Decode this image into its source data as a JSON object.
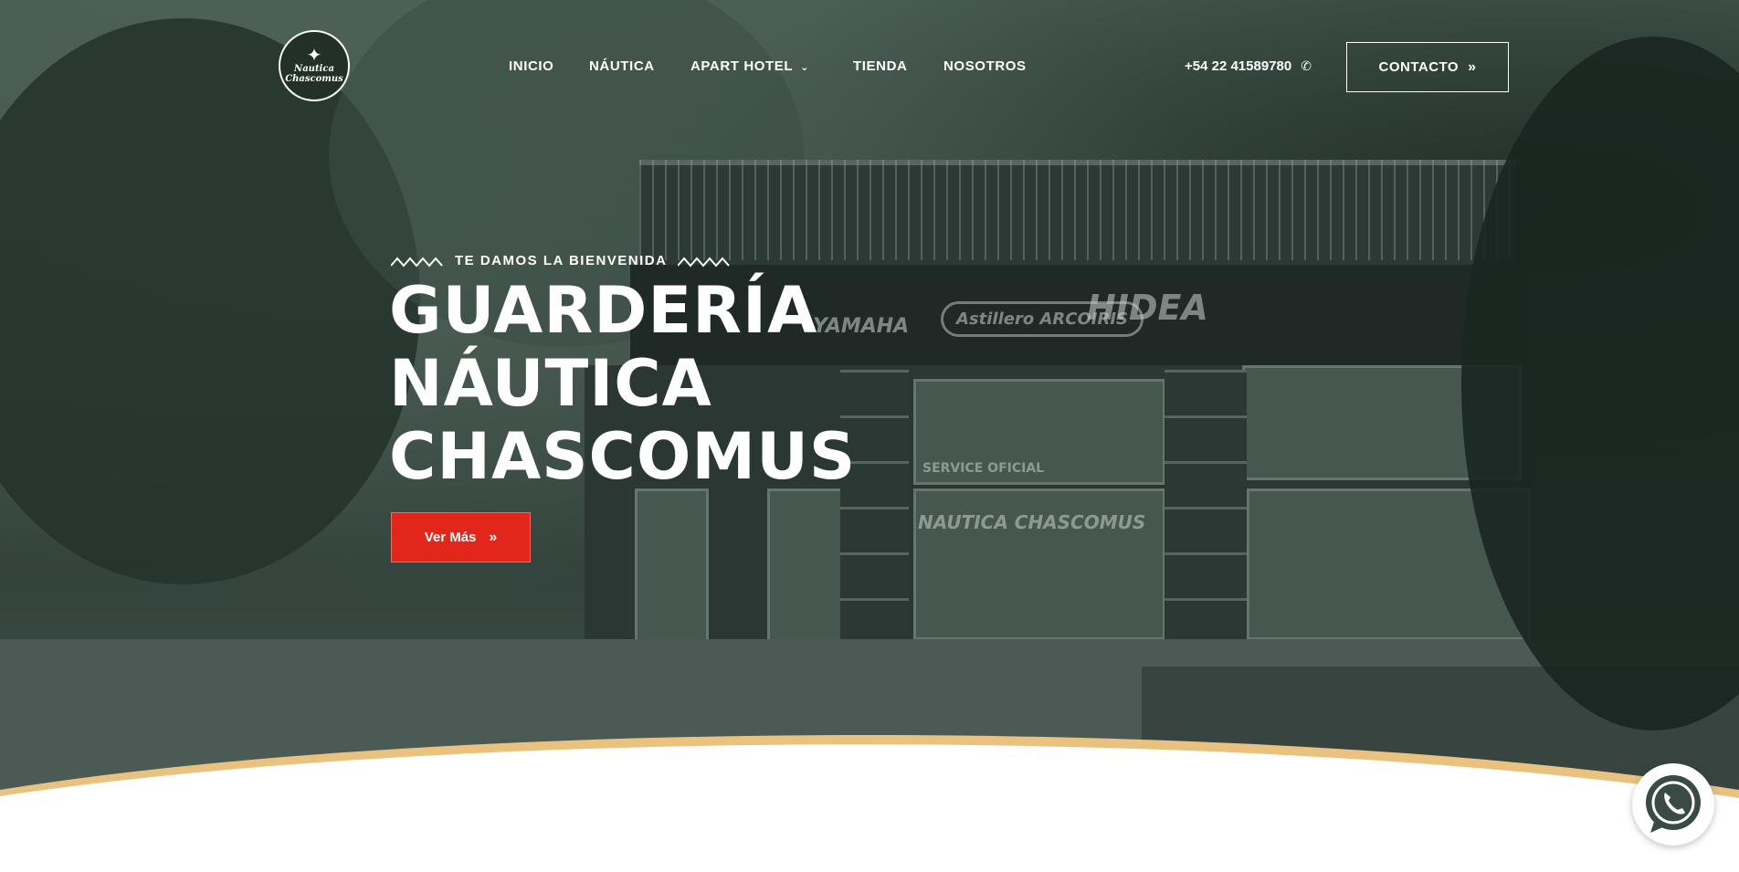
{
  "brand": {
    "logo_line1": "Nautica",
    "logo_line2": "Chascomus"
  },
  "nav": {
    "items": [
      "INICIO",
      "NÁUTICA",
      "APART HOTEL",
      "TIENDA",
      "NOSOTROS"
    ],
    "phone": "+54 22 41589780",
    "contact_label": "CONTACTO"
  },
  "hero": {
    "eyebrow": "TE DAMOS LA BIENVENIDA",
    "title_lines": [
      "GUARDERÍA",
      "NÁUTICA",
      "CHASCOMUS"
    ],
    "cta_label": "Ver Más"
  },
  "background_signs": [
    "YAMAHA",
    "Astillero ARCOIRIS",
    "HIDEA",
    "SERVICE OFICIAL",
    "NAUTICA CHASCOMUS"
  ],
  "icons": [
    "logo-icon",
    "chevron-down-icon",
    "phone-icon",
    "double-chevron-right-icon",
    "whatsapp-icon"
  ],
  "colors": {
    "accent_red": "#e3261c",
    "overlay_green": "#3c4d46",
    "curve_gold": "#e9c27f",
    "white": "#ffffff"
  }
}
